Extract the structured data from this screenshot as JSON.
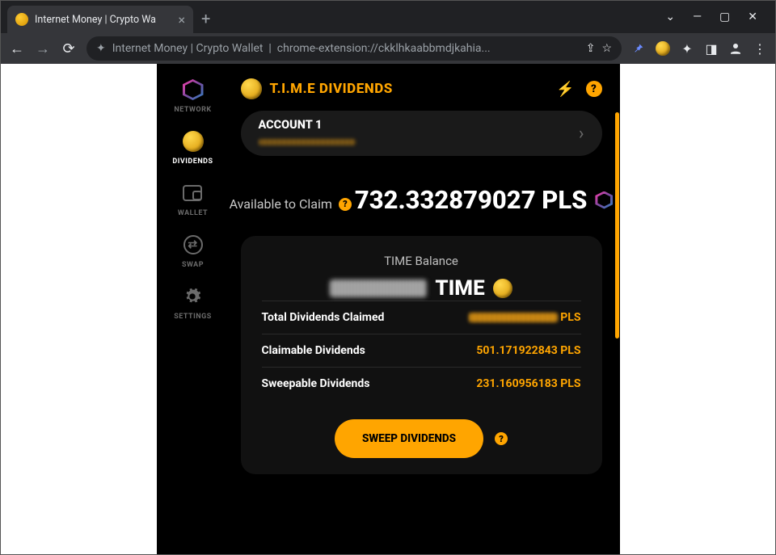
{
  "browser": {
    "tab_title": "Internet Money | Crypto Wa",
    "omnibox_prefix": "Internet Money | Crypto Wallet",
    "omnibox_url": "chrome-extension://ckklhkaabbmdjkahia..."
  },
  "sidebar": {
    "items": [
      {
        "label": "NETWORK"
      },
      {
        "label": "DIVIDENDS"
      },
      {
        "label": "WALLET"
      },
      {
        "label": "SWAP"
      },
      {
        "label": "SETTINGS"
      }
    ]
  },
  "header": {
    "title": "T.I.M.E DIVIDENDS"
  },
  "account": {
    "name": "ACCOUNT 1"
  },
  "claim": {
    "label": "Available to Claim",
    "amount": "732.332879027 PLS"
  },
  "panel": {
    "title": "TIME Balance",
    "unit": "TIME",
    "rows": [
      {
        "label": "Total Dividends Claimed",
        "value_hidden": true,
        "suffix": "PLS"
      },
      {
        "label": "Claimable Dividends",
        "value": "501.171922843 PLS"
      },
      {
        "label": "Sweepable Dividends",
        "value": "231.160956183 PLS"
      }
    ]
  },
  "cta": {
    "label": "SWEEP DIVIDENDS"
  }
}
